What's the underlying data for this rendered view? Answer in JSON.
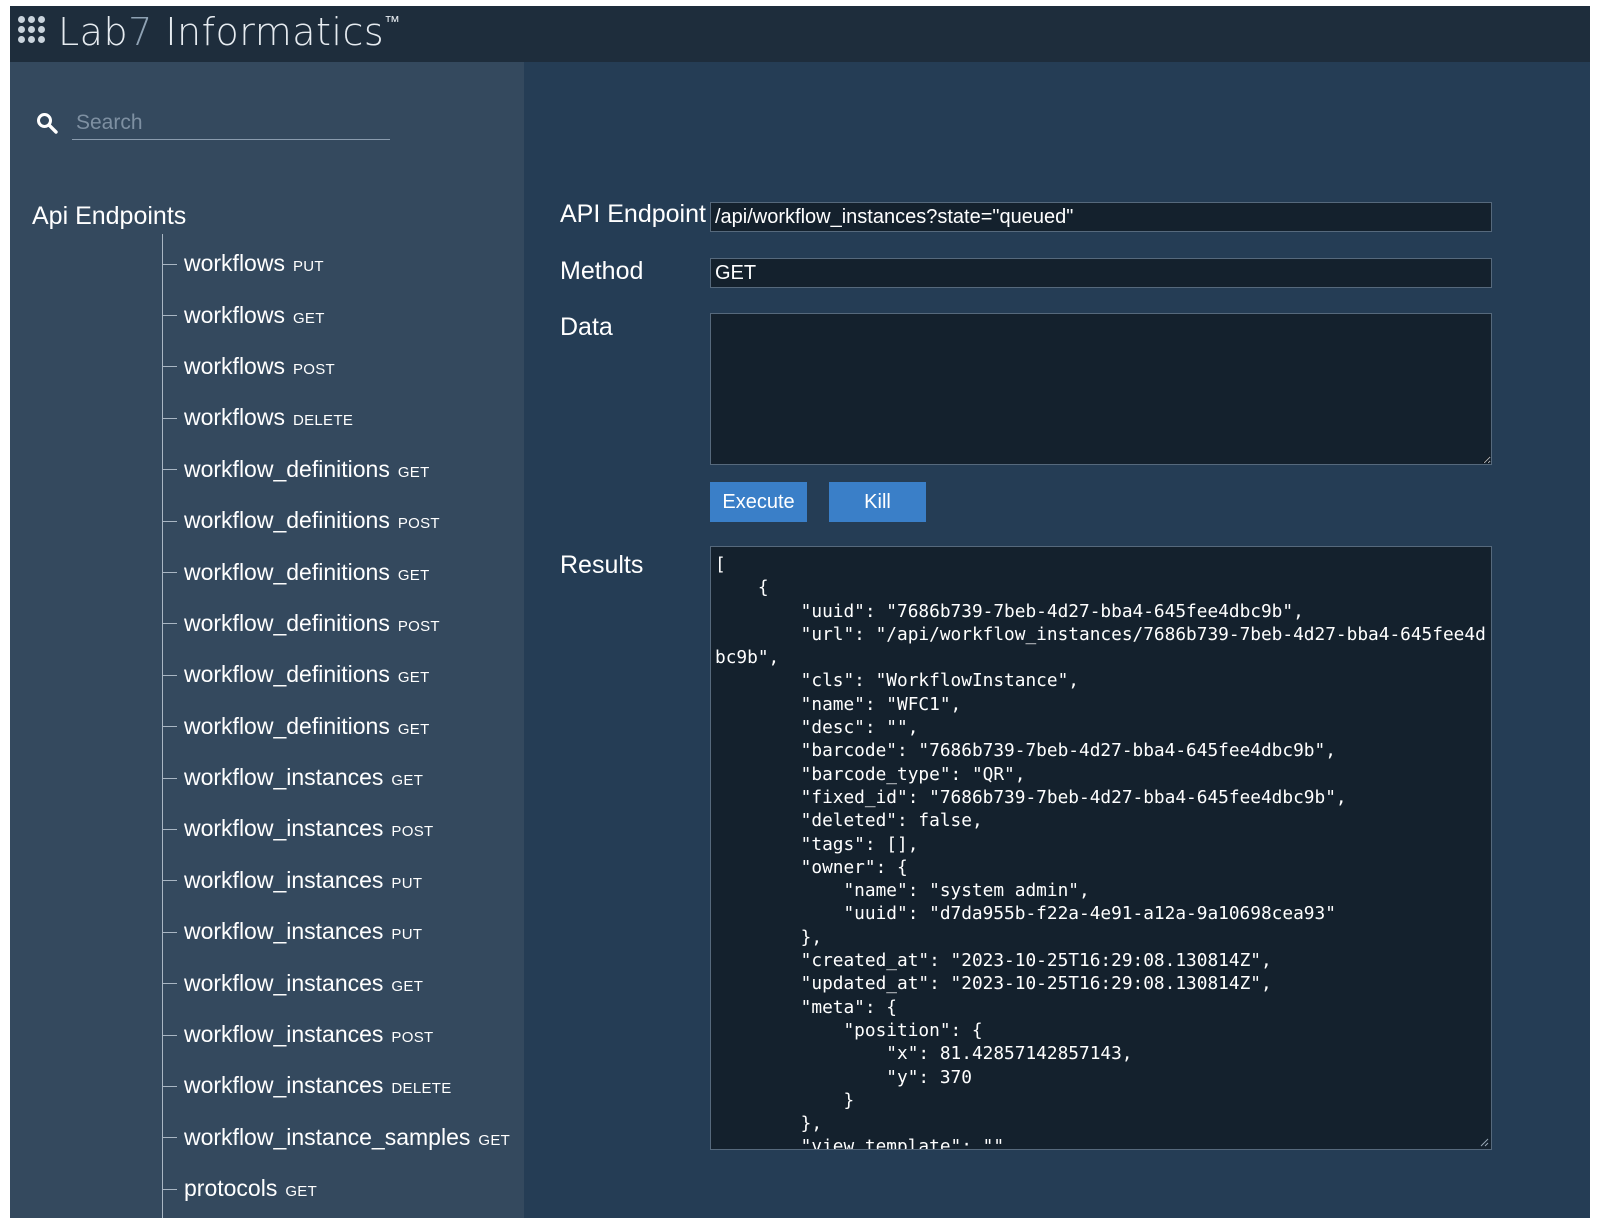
{
  "app": {
    "brand_main": "Lab",
    "brand_seven": "7",
    "brand_rest": " Informatics",
    "brand_tm": "™"
  },
  "search": {
    "placeholder": "Search"
  },
  "sidebar": {
    "title": "Api Endpoints",
    "endpoints": [
      {
        "name": "workflows",
        "method": "PUT"
      },
      {
        "name": "workflows",
        "method": "GET"
      },
      {
        "name": "workflows",
        "method": "POST"
      },
      {
        "name": "workflows",
        "method": "DELETE"
      },
      {
        "name": "workflow_definitions",
        "method": "GET"
      },
      {
        "name": "workflow_definitions",
        "method": "POST"
      },
      {
        "name": "workflow_definitions",
        "method": "GET"
      },
      {
        "name": "workflow_definitions",
        "method": "POST"
      },
      {
        "name": "workflow_definitions",
        "method": "GET"
      },
      {
        "name": "workflow_definitions",
        "method": "GET"
      },
      {
        "name": "workflow_instances",
        "method": "GET"
      },
      {
        "name": "workflow_instances",
        "method": "POST"
      },
      {
        "name": "workflow_instances",
        "method": "PUT"
      },
      {
        "name": "workflow_instances",
        "method": "PUT"
      },
      {
        "name": "workflow_instances",
        "method": "GET"
      },
      {
        "name": "workflow_instances",
        "method": "POST"
      },
      {
        "name": "workflow_instances",
        "method": "DELETE"
      },
      {
        "name": "workflow_instance_samples",
        "method": "GET"
      },
      {
        "name": "protocols",
        "method": "GET"
      }
    ]
  },
  "form": {
    "endpoint_label": "API Endpoint",
    "endpoint_value": "/api/workflow_instances?state=\"queued\"",
    "method_label": "Method",
    "method_value": "GET",
    "data_label": "Data",
    "data_value": "",
    "execute_label": "Execute",
    "kill_label": "Kill",
    "results_label": "Results",
    "results_text": "[\n    {\n        \"uuid\": \"7686b739-7beb-4d27-bba4-645fee4dbc9b\",\n        \"url\": \"/api/workflow_instances/7686b739-7beb-4d27-bba4-645fee4dbc9b\",\n        \"cls\": \"WorkflowInstance\",\n        \"name\": \"WFC1\",\n        \"desc\": \"\",\n        \"barcode\": \"7686b739-7beb-4d27-bba4-645fee4dbc9b\",\n        \"barcode_type\": \"QR\",\n        \"fixed_id\": \"7686b739-7beb-4d27-bba4-645fee4dbc9b\",\n        \"deleted\": false,\n        \"tags\": [],\n        \"owner\": {\n            \"name\": \"system admin\",\n            \"uuid\": \"d7da955b-f22a-4e91-a12a-9a10698cea93\"\n        },\n        \"created_at\": \"2023-10-25T16:29:08.130814Z\",\n        \"updated_at\": \"2023-10-25T16:29:08.130814Z\",\n        \"meta\": {\n            \"position\": {\n                \"x\": 81.42857142857143,\n                \"y\": 370\n            }\n        },\n        \"view_template\": \"\","
  }
}
